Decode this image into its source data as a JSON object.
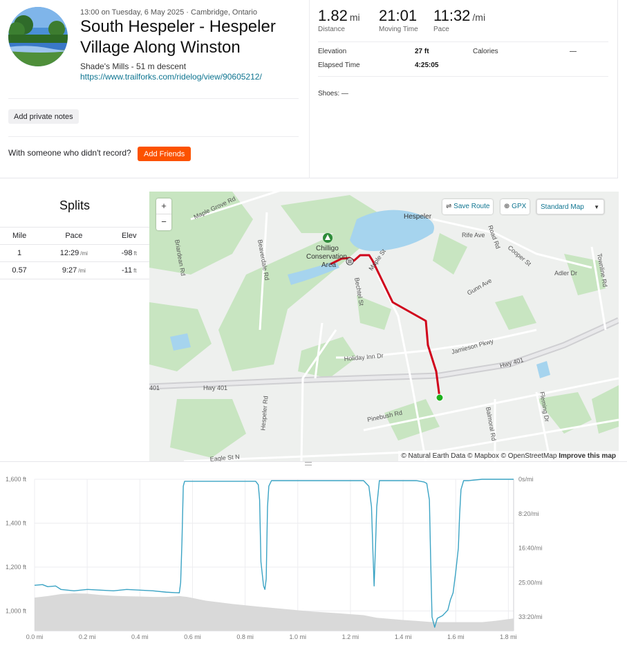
{
  "activity": {
    "date_line": "13:00 on Tuesday, 6 May 2025 · Cambridge, Ontario",
    "title": "South Hespeler - Hespeler Village Along Winston",
    "description": "Shade's Mills - 51 m descent",
    "link": "https://www.trailforks.com/ridelog/view/90605212/",
    "avatar_icon": "landscape-photo"
  },
  "actions": {
    "private_notes": "Add private notes",
    "with_someone": "With someone who didn't record?",
    "add_friends": "Add Friends",
    "add_friends_color": "#fc5200"
  },
  "stats": {
    "distance": {
      "value": "1.82",
      "unit": "mi",
      "label": "Distance"
    },
    "moving_time": {
      "value": "21:01",
      "label": "Moving Time"
    },
    "pace": {
      "value": "11:32",
      "unit": "/mi",
      "label": "Pace"
    },
    "elevation_label": "Elevation",
    "elevation_value": "27 ft",
    "calories_label": "Calories",
    "calories_value": "—",
    "elapsed_label": "Elapsed Time",
    "elapsed_value": "4:25:05",
    "shoes": "Shoes: —"
  },
  "splits": {
    "title": "Splits",
    "headers": [
      "Mile",
      "Pace",
      "Elev"
    ],
    "rows": [
      {
        "mile": "1",
        "pace": "12:29",
        "pace_unit": "/mi",
        "elev": "-98",
        "elev_unit": "ft"
      },
      {
        "mile": "0.57",
        "pace": "9:27",
        "pace_unit": "/mi",
        "elev": "-11",
        "elev_unit": "ft"
      }
    ]
  },
  "map": {
    "zoom_in": "+",
    "zoom_out": "−",
    "save_route": "Save Route",
    "gpx": "GPX",
    "map_style": "Standard Map",
    "attribution": "© Natural Earth Data © Mapbox © OpenStreetMap",
    "improve": "Improve this map",
    "route_color": "#d0021b",
    "start_color": "#1db01d",
    "labels": {
      "maple_grove": "Maple Grove Rd",
      "hespeler": "Hespeler",
      "chilligo": "Chilligo",
      "conservation": "Conservation",
      "area": "Area",
      "rife": "Rife Ave",
      "cooper": "Cooper St",
      "townline": "Townline Rd",
      "adler": "Adler Dr",
      "gunn": "Gunn Ave",
      "maple_st": "Maple St",
      "bechtel": "Bechtel St",
      "beaverdale": "Beaverdale Rd",
      "briardean": "Briardean Rd",
      "jamieson": "Jamieson Pkwy",
      "holiday_inn": "Holiday Inn Dr",
      "hwy401a": "Hwy 401",
      "hwy401b": "Hwy 401",
      "n401": "401",
      "hespeler_rd": "Hespeler Rd",
      "pinebush": "Pinebush Rd",
      "balmoral": "Balmoral Rd",
      "fleming": "Fleming Dr",
      "eagle": "Eagle St N",
      "road_rd": "Road Rd"
    }
  },
  "chart_data": {
    "type": "area",
    "x_unit": "mi",
    "x_range": [
      0,
      1.82
    ],
    "x_ticks": [
      "0.0 mi",
      "0.2 mi",
      "0.4 mi",
      "0.6 mi",
      "0.8 mi",
      "1.0 mi",
      "1.2 mi",
      "1.4 mi",
      "1.6 mi",
      "1.8 mi"
    ],
    "y_left_ticks": [
      "1,600 ft",
      "1,400 ft",
      "1,200 ft",
      "1,000 ft"
    ],
    "y_left_range": [
      910,
      1600
    ],
    "y_right_ticks": [
      "0s/mi",
      "8:20/mi",
      "16:40/mi",
      "25:00/mi",
      "33:20/mi"
    ],
    "y_right_range_s_per_mi": [
      0,
      2200
    ],
    "grid": true,
    "elevation_color": "#d9d9d9",
    "pace_color": "#3aa3c4",
    "elevation": {
      "name": "Elevation (ft)",
      "x": [
        0,
        0.05,
        0.1,
        0.15,
        0.2,
        0.25,
        0.3,
        0.35,
        0.4,
        0.45,
        0.5,
        0.55,
        0.58,
        0.65,
        0.75,
        0.85,
        0.95,
        1.05,
        1.15,
        1.25,
        1.3,
        1.35,
        1.4,
        1.45,
        1.5,
        1.55,
        1.6,
        1.65,
        1.7,
        1.75,
        1.82
      ],
      "y": [
        1061,
        1068,
        1077,
        1080,
        1079,
        1073,
        1069,
        1067,
        1066,
        1064,
        1064,
        1068,
        1064,
        1047,
        1032,
        1020,
        1009,
        998,
        990,
        981,
        969,
        964,
        959,
        955,
        950,
        949,
        949,
        949,
        949,
        955,
        966
      ]
    },
    "pace": {
      "name": "Pace (s/mi)",
      "x": [
        0,
        0.03,
        0.05,
        0.08,
        0.1,
        0.15,
        0.2,
        0.25,
        0.3,
        0.35,
        0.4,
        0.45,
        0.5,
        0.55,
        0.555,
        0.56,
        0.565,
        0.57,
        0.6,
        0.65,
        0.7,
        0.75,
        0.8,
        0.84,
        0.85,
        0.855,
        0.86,
        0.87,
        0.875,
        0.88,
        0.885,
        0.89,
        0.9,
        1.0,
        1.1,
        1.2,
        1.25,
        1.27,
        1.28,
        1.285,
        1.29,
        1.295,
        1.3,
        1.31,
        1.35,
        1.4,
        1.45,
        1.48,
        1.49,
        1.5,
        1.505,
        1.51,
        1.52,
        1.53,
        1.55,
        1.57,
        1.58,
        1.59,
        1.6,
        1.61,
        1.615,
        1.62,
        1.63,
        1.65,
        1.7,
        1.82
      ],
      "y": [
        1540,
        1530,
        1560,
        1550,
        1600,
        1620,
        1600,
        1610,
        1620,
        1600,
        1610,
        1620,
        1640,
        1650,
        1500,
        900,
        100,
        30,
        30,
        30,
        30,
        30,
        30,
        30,
        80,
        300,
        1200,
        1550,
        1600,
        1450,
        400,
        100,
        20,
        20,
        20,
        20,
        20,
        100,
        400,
        1000,
        1550,
        1000,
        400,
        20,
        20,
        20,
        20,
        40,
        60,
        300,
        1200,
        2000,
        2150,
        2020,
        1980,
        1900,
        1750,
        1650,
        1350,
        1000,
        500,
        150,
        20,
        20,
        0,
        0
      ]
    }
  }
}
